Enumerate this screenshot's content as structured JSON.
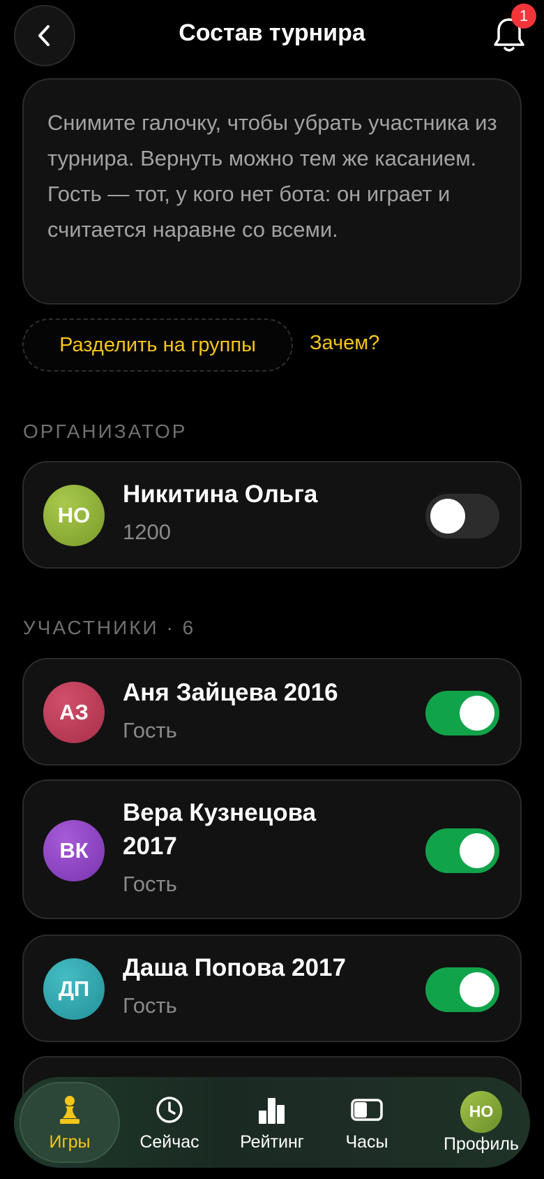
{
  "header": {
    "title": "Состав турнира",
    "notification_count": "1"
  },
  "info": {
    "text": "Снимите галочку, чтобы убрать участника из турнира. Вернуть можно тем же касанием. Гость — тот, у кого нет бота: он играет и считается наравне со всеми."
  },
  "actions": {
    "group_button": "Разделить на группы",
    "why_link": "Зачем?"
  },
  "organizer": {
    "section_label": "ОРГАНИЗАТОР",
    "initials": "НО",
    "name": "Никитина Ольга",
    "rating": "1200",
    "included": false,
    "avatar_color": "#8fb23a"
  },
  "participants": {
    "section_label": "УЧАСТНИКИ · 6",
    "items": [
      {
        "initials": "АЗ",
        "name": "Аня Зайцева 2016",
        "sub": "Гость",
        "included": true,
        "avatar_color": "#c23d5a"
      },
      {
        "initials": "ВК",
        "name": "Вера Кузнецова 2017",
        "sub": "Гость",
        "included": true,
        "avatar_color": "#8e44c7"
      },
      {
        "initials": "ДП",
        "name": "Даша Попова 2017",
        "sub": "Гость",
        "included": true,
        "avatar_color": "#2fa7ae"
      }
    ]
  },
  "tabbar": {
    "items": [
      {
        "label": "Игры",
        "icon": "pawn-icon",
        "active": true
      },
      {
        "label": "Сейчас",
        "icon": "clock-icon",
        "active": false
      },
      {
        "label": "Рейтинг",
        "icon": "bar-chart-icon",
        "active": false
      },
      {
        "label": "Часы",
        "icon": "chess-clock-icon",
        "active": false
      },
      {
        "label": "Профиль",
        "icon": "avatar",
        "initials": "НО",
        "active": false
      }
    ]
  },
  "colors": {
    "accent": "#f5c518",
    "toggle_on": "#11a34a",
    "badge": "#f2353a"
  }
}
